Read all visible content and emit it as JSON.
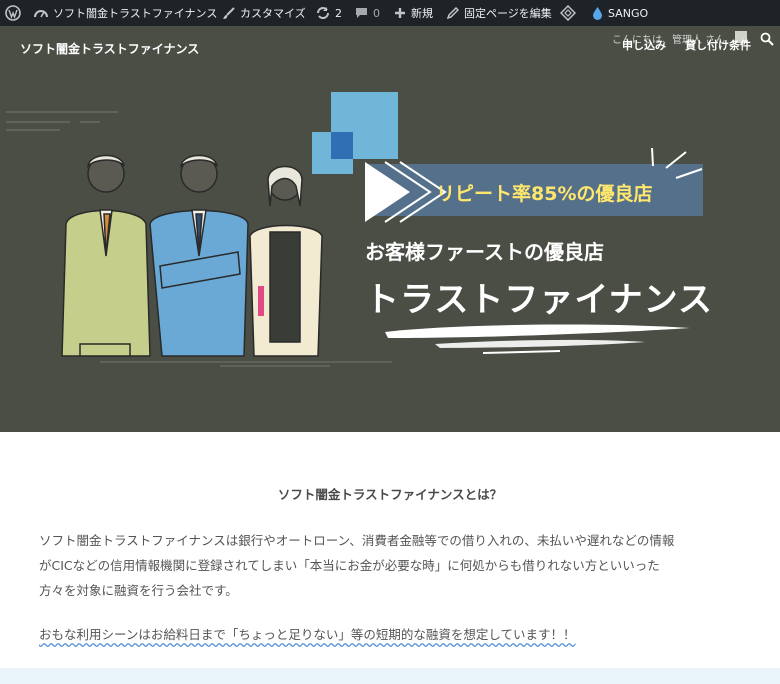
{
  "admin_bar": {
    "site_name": "ソフト闇金トラストファイナンス",
    "customize": "カスタマイズ",
    "updates_count": "2",
    "comments_count": "0",
    "new": "新規",
    "edit_page": "固定ページを編集",
    "theme": "SANGO"
  },
  "header": {
    "site_title": "ソフト闇金トラストファイナンス",
    "greeting": "こんにちは、管理人 さん",
    "nav": [
      "申し込み",
      "貸し付け条件"
    ]
  },
  "hero": {
    "badge": "リピート率85%の優良店",
    "tagline": "お客様ファーストの優良店",
    "brand": "トラストファイナンス"
  },
  "main": {
    "heading": "ソフト闇金トラストファイナンスとは？",
    "paragraph_lines": [
      "ソフト闇金トラストファイナンスは銀行やオートローン、消費者金融等での借り入れの、未払いや遅れなどの情報",
      "がCICなどの信用情報機関に登録されてしまい「本当にお金が必要な時」に何処からも借りれない方といいった",
      "方々を対象に融資を行う会社です。"
    ],
    "usage_line": "おもな利用シーンはお給料日まで「ちょっと足りない」等の短期的な融資を想定しています！！"
  },
  "colors": {
    "admin_bar": "#1d2327",
    "hero_bg": "#4a4e45",
    "badge_text": "#ffe66d",
    "square_light": "#6fb6d8",
    "square_dark": "#2f6fb4",
    "link_underline": "#4f8fd8"
  }
}
